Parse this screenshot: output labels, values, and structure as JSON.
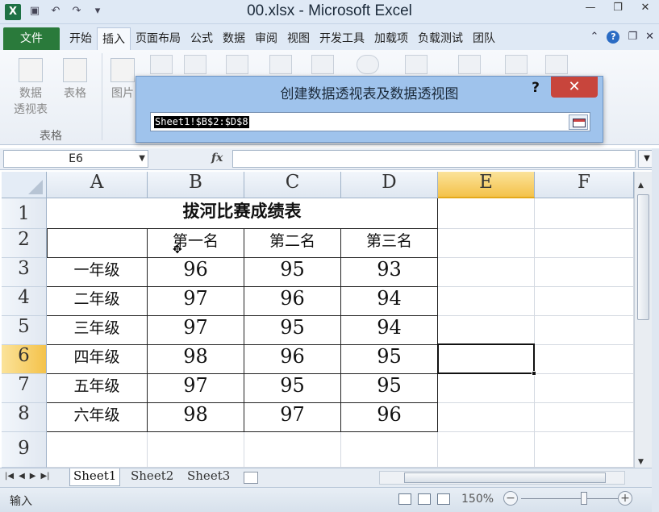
{
  "window": {
    "title": "00.xlsx - Microsoft Excel",
    "app_icon_letter": "X"
  },
  "ribbon": {
    "tabs": [
      "文件",
      "开始",
      "插入",
      "页面布局",
      "公式",
      "数据",
      "审阅",
      "视图",
      "开发工具",
      "加载项",
      "负载测试",
      "团队"
    ],
    "active_tab": "插入",
    "buttons": {
      "pivot_line1": "数据",
      "pivot_line2": "透视表",
      "table": "表格",
      "picture": "图片"
    },
    "group_label": "表格"
  },
  "dialog": {
    "title": "创建数据透视表及数据透视图",
    "help": "?",
    "close": "✕",
    "range_value": "Sheet1!$B$2:$D$8"
  },
  "formula_bar": {
    "name_box": "E6",
    "fx": "fx",
    "content": ""
  },
  "grid": {
    "columns": [
      "A",
      "B",
      "C",
      "D",
      "E",
      "F"
    ],
    "rows": [
      "1",
      "2",
      "3",
      "4",
      "5",
      "6",
      "7",
      "8",
      "9"
    ],
    "active_column": "E",
    "active_row": "6",
    "title": "拔河比赛成绩表",
    "headers": [
      "第一名",
      "第二名",
      "第三名"
    ],
    "data": [
      {
        "grade": "一年级",
        "values": [
          "96",
          "95",
          "93"
        ]
      },
      {
        "grade": "二年级",
        "values": [
          "97",
          "96",
          "94"
        ]
      },
      {
        "grade": "三年级",
        "values": [
          "97",
          "95",
          "94"
        ]
      },
      {
        "grade": "四年级",
        "values": [
          "98",
          "96",
          "95"
        ]
      },
      {
        "grade": "五年级",
        "values": [
          "97",
          "95",
          "95"
        ]
      },
      {
        "grade": "六年级",
        "values": [
          "98",
          "97",
          "96"
        ]
      }
    ]
  },
  "sheets": [
    "Sheet1",
    "Sheet2",
    "Sheet3"
  ],
  "active_sheet": "Sheet1",
  "status": {
    "mode": "输入",
    "zoom": "150%"
  }
}
